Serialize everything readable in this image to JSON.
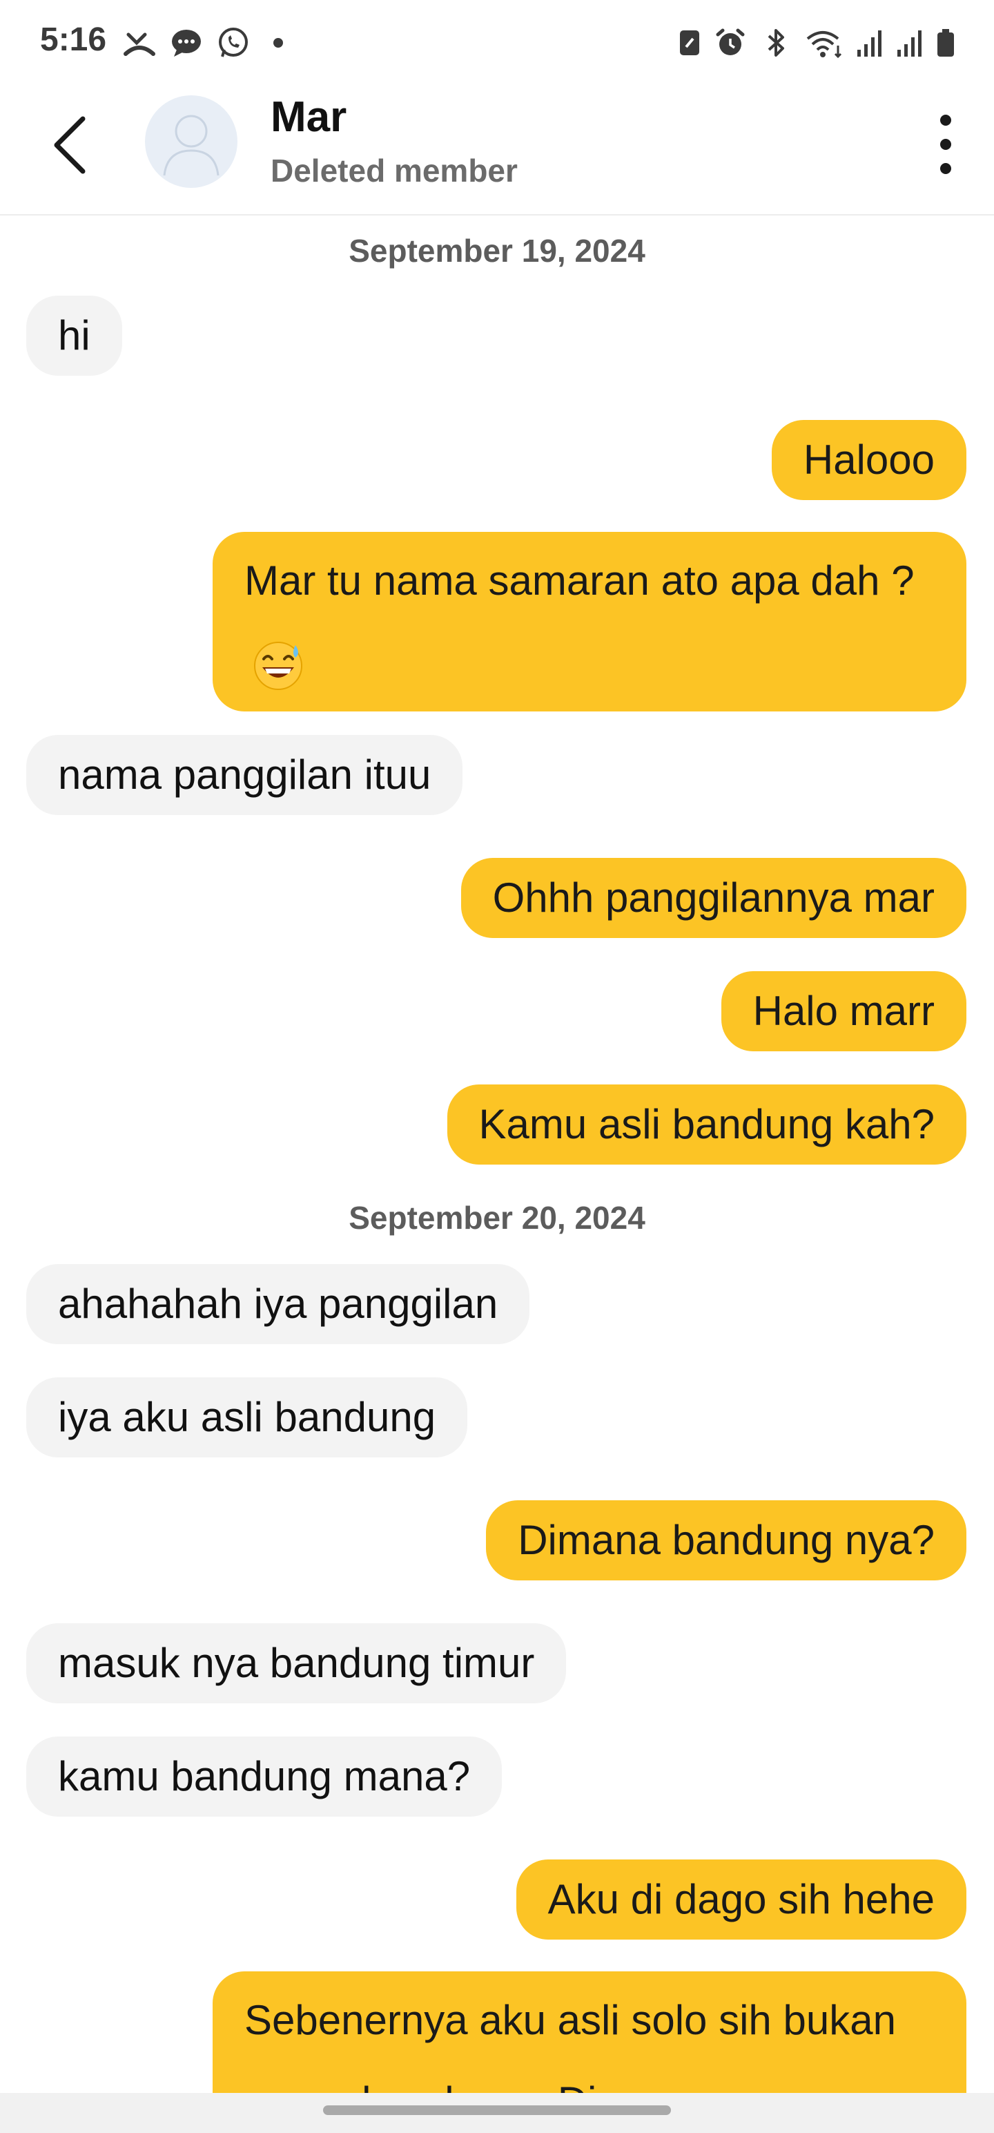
{
  "status_bar": {
    "time": "5:16",
    "left_icons": [
      "missed-call-icon",
      "chat-bubble-icon",
      "whatsapp-icon"
    ],
    "right_icons": [
      "nfc-icon",
      "alarm-icon",
      "bluetooth-icon",
      "wifi-icon",
      "signal-icon",
      "signal-icon",
      "battery-icon"
    ]
  },
  "header": {
    "name": "Mar",
    "subtitle": "Deleted member"
  },
  "messages": [
    {
      "type": "date",
      "text": "September 19, 2024"
    },
    {
      "type": "in",
      "text": "hi"
    },
    {
      "type": "out",
      "text": "Halooo"
    },
    {
      "type": "out",
      "text": "Mar tu nama samaran ato apa dah ?",
      "emoji": "grinning-sweat-emoji"
    },
    {
      "type": "in",
      "text": "nama panggilan ituu"
    },
    {
      "type": "out",
      "text": "Ohhh panggilannya mar"
    },
    {
      "type": "out",
      "text": "Halo marr"
    },
    {
      "type": "out",
      "text": "Kamu asli bandung kah?"
    },
    {
      "type": "date",
      "text": "September 20, 2024"
    },
    {
      "type": "in",
      "text": "ahahahah iya panggilan"
    },
    {
      "type": "in",
      "text": "iya aku asli bandung"
    },
    {
      "type": "out",
      "text": "Dimana bandung nya?"
    },
    {
      "type": "in",
      "text": "masuk nya bandung timur"
    },
    {
      "type": "in",
      "text": "kamu bandung mana?"
    },
    {
      "type": "out",
      "text": "Aku di dago sih hehe"
    },
    {
      "type": "out",
      "text": "Sebenernya aku asli solo sih bukan orang bandung . Di"
    }
  ],
  "colors": {
    "outgoing_bubble": "#fcc425",
    "incoming_bubble": "#f3f3f3",
    "date_text": "#5c5c5c"
  }
}
